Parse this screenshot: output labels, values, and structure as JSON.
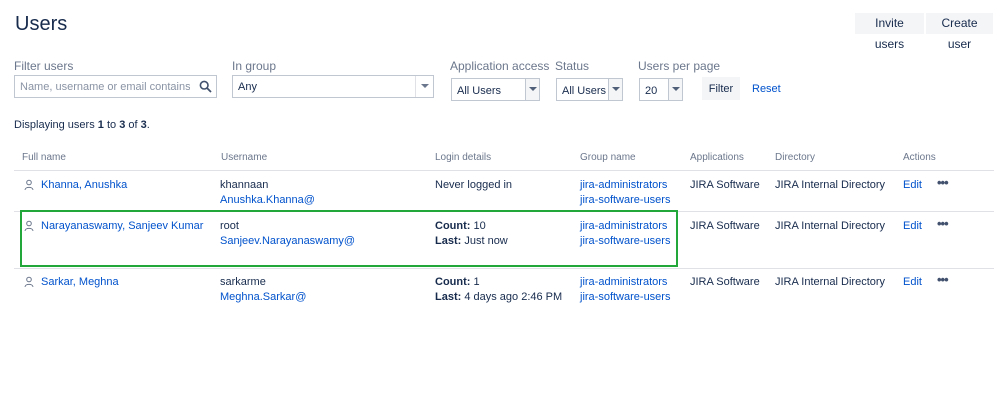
{
  "page": {
    "title": "Users",
    "invite_label": "Invite users",
    "create_label": "Create user"
  },
  "filters": {
    "filter_users_label": "Filter users",
    "search_placeholder": "Name, username or email contains",
    "search_value": "",
    "in_group_label": "In group",
    "in_group_value": "Any",
    "app_access_label": "Application access",
    "app_access_value": "All Users",
    "status_label": "Status",
    "status_value": "All Users",
    "per_page_label": "Users per page",
    "per_page_value": "20",
    "filter_button": "Filter",
    "reset_link": "Reset"
  },
  "summary": {
    "prefix": "Displaying users",
    "from": "1",
    "to_word": "to",
    "to": "3",
    "of_word": "of",
    "total": "3",
    "suffix": "."
  },
  "table": {
    "headers": {
      "full_name": "Full name",
      "username": "Username",
      "login": "Login details",
      "groups": "Group name",
      "applications": "Applications",
      "directory": "Directory",
      "actions": "Actions"
    },
    "rows": [
      {
        "full_name": "Khanna, Anushka",
        "username": "khannaan",
        "email": "Anushka.Khanna@",
        "login_line1_label": "",
        "login_line1_value": "Never logged in",
        "login_line2_label": "",
        "login_line2_value": "",
        "group1": "jira-administrators",
        "group2": "jira-software-users",
        "application": "JIRA Software",
        "directory": "JIRA Internal Directory",
        "edit": "Edit",
        "more": "•••"
      },
      {
        "full_name": "Narayanaswamy, Sanjeev Kumar",
        "username": "root",
        "email": "Sanjeev.Narayanaswamy@",
        "login_line1_label": "Count:",
        "login_line1_value": "10",
        "login_line2_label": "Last:",
        "login_line2_value": "Just now",
        "group1": "jira-administrators",
        "group2": "jira-software-users",
        "application": "JIRA Software",
        "directory": "JIRA Internal Directory",
        "edit": "Edit",
        "more": "•••"
      },
      {
        "full_name": "Sarkar, Meghna",
        "username": "sarkarme",
        "email": "Meghna.Sarkar@",
        "login_line1_label": "Count:",
        "login_line1_value": "1",
        "login_line2_label": "Last:",
        "login_line2_value": "4 days ago 2:46 PM",
        "group1": "jira-administrators",
        "group2": "jira-software-users",
        "application": "JIRA Software",
        "directory": "JIRA Internal Directory",
        "edit": "Edit",
        "more": "•••"
      }
    ]
  },
  "colors": {
    "link": "#0052cc",
    "highlight": "#22a83a",
    "muted": "#6b778c"
  },
  "icons": [
    "search-icon",
    "user-icon",
    "chevron-down-icon",
    "more-icon"
  ]
}
